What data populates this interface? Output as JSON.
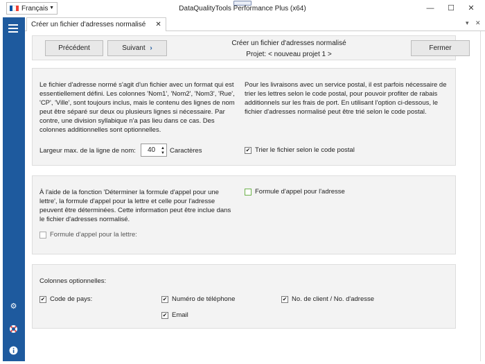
{
  "titlebar": {
    "language": "Français",
    "window_title": "DataQualityTools Performance Plus (x64)",
    "minimize": "—",
    "maximize": "☐",
    "close": "✕"
  },
  "flag_colors": [
    "#0055a4",
    "#ffffff",
    "#ef4135"
  ],
  "sidebar": {
    "menu_icon": "hamburger-icon",
    "bottom_icons": [
      "gear-icon",
      "lifebuoy-icon",
      "info-icon"
    ],
    "color": "#1e5a9e"
  },
  "tab": {
    "label": "Créer un fichier d'adresses normalisé",
    "close": "✕"
  },
  "tab_controls": {
    "dropdown": "▾",
    "close": "✕"
  },
  "toolbar": {
    "previous": "Précédent",
    "next": "Suivant",
    "next_arrow": "›",
    "heading": "Créer un fichier d'adresses normalisé",
    "project": "Projet: < nouveau projet 1 >",
    "close": "Fermer"
  },
  "section1": {
    "left_text": "Le fichier d'adresse normé s'agit d'un fichier avec un format qui est essentiellement défini. Les colonnes 'Nom1', 'Nom2', 'Nom3', 'Rue', 'CP', 'Ville', sont toujours inclus, mais le contenu des lignes de nom peut être séparé sur deux ou plusieurs lignes si nécessaire.  Par contre, une division syllabique n'a pas lieu dans ce cas. Des colonnes additionnelles sont optionnelles.",
    "right_text": "Pour les livraisons avec un service postal, il est parfois nécessaire de trier les lettres selon le code postal, pour pouvoir profiter de rabais additionnels sur les frais de port. En utilisant l'option ci-dessous, le fichier d'adresses normalisé peut être trié selon le code postal.",
    "max_width_label": "Largeur max. de la ligne de nom:",
    "max_width_value": "40",
    "max_width_unit": "Caractères",
    "sort_label": "Trier le fichier selon le code postal",
    "sort_checked": "✔"
  },
  "section2": {
    "text": "À l'aide de la fonction 'Déterminer la formule d'appel pour une lettre', la formule d'appel pour la lettre et celle pour l'adresse peuvent être déterminées. Cette information peut être inclue dans le fichier d'adresses normalisé.",
    "letter_label": "Formule d'appel pour la lettre:",
    "address_label": "Formule d'appel pour l'adresse"
  },
  "section3": {
    "heading": "Colonnes optionnelles:",
    "country": "Code de pays:",
    "phone": "Numéro de téléphone",
    "client": "No. de client / No. d'adresse",
    "email": "Email",
    "checkmark": "✔"
  }
}
